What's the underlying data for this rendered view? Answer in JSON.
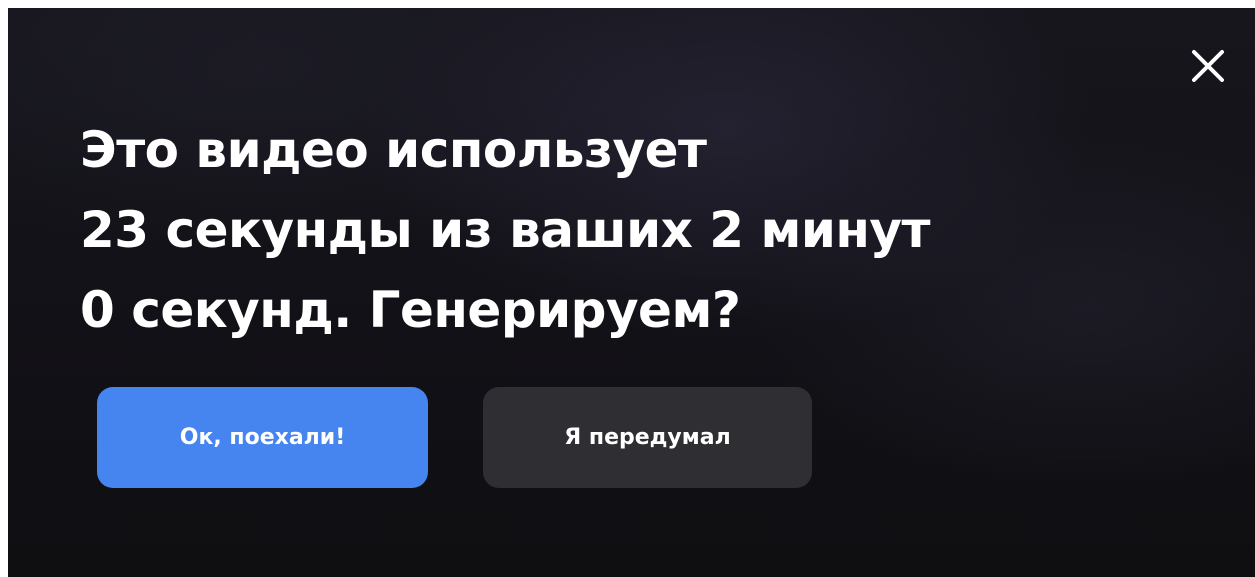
{
  "dialog": {
    "message_lines": [
      "Это видео использует",
      "23 секунды из ваших 2 минут",
      "0 секунд. Генерируем?"
    ],
    "confirm_label": "Ок, поехали!",
    "cancel_label": "Я передумал",
    "close_icon": "close-icon"
  },
  "colors": {
    "confirm_button": "#4684f0",
    "cancel_button": "#2f2e33",
    "background": "#121117",
    "text": "#ffffff"
  }
}
